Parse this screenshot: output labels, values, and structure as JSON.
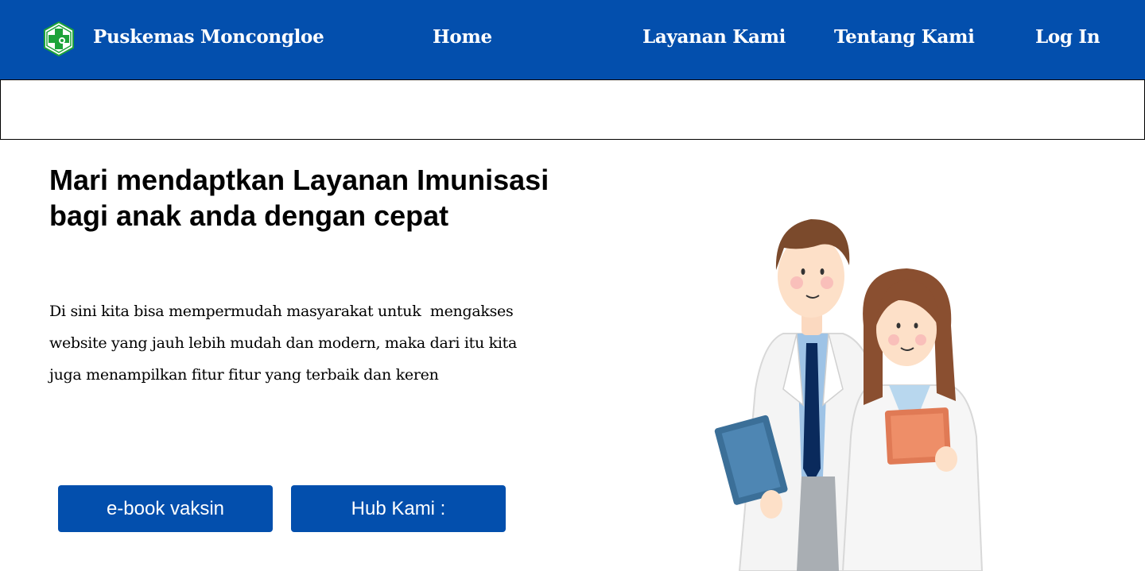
{
  "header": {
    "brand": "Puskemas Moncongloe",
    "nav": {
      "home": "Home",
      "layanan": "Layanan Kami",
      "tentang": "Tentang Kami",
      "login": "Log In"
    }
  },
  "hero": {
    "title_line1": "Mari mendaptkan Layanan Imunisasi",
    "title_line2": "bagi anak anda dengan cepat",
    "desc_line1": "Di sini kita bisa mempermudah masyarakat untuk  mengakses",
    "desc_line2": "website yang jauh lebih mudah dan modern, maka dari itu kita",
    "desc_line3": "juga menampilkan fitur fitur yang terbaik dan keren"
  },
  "buttons": {
    "ebook": "e-book vaksin",
    "hub": "Hub Kami :"
  },
  "icons": {
    "logo": "health-cross-logo-icon",
    "illustration": "doctors-illustration"
  },
  "colors": {
    "primary": "#034FAD",
    "logo_green": "#1DA33A",
    "text": "#000000",
    "background": "#FFFFFF"
  }
}
